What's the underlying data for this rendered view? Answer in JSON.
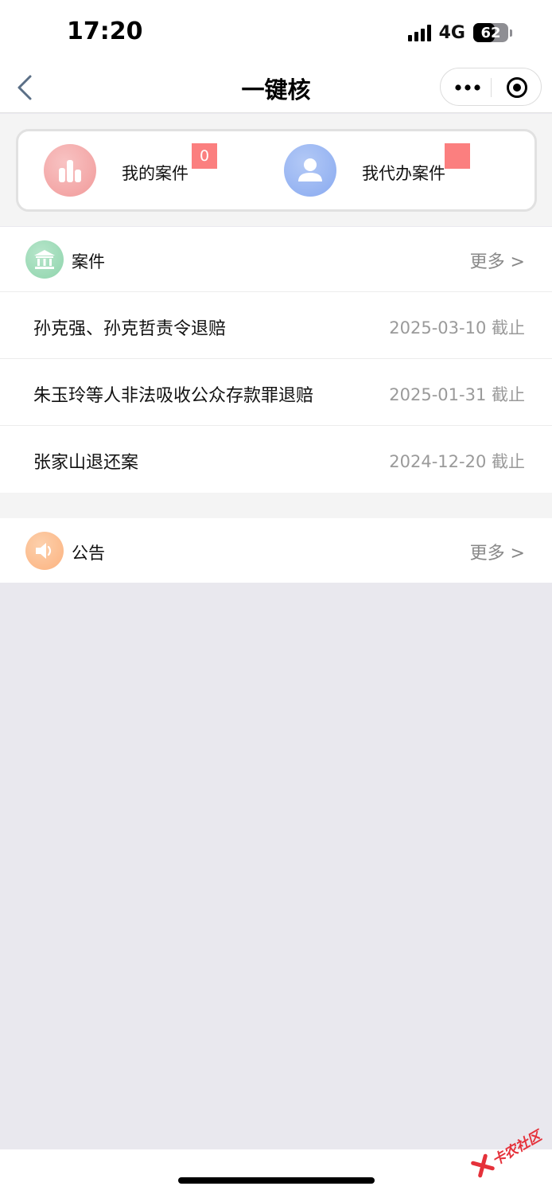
{
  "status_bar": {
    "time": "17:20",
    "network": "4G",
    "battery": "62",
    "battery_level": 0.62
  },
  "nav": {
    "title": "一键核",
    "back_icon": "chevron-left-icon",
    "more_icon": "more-dots-icon",
    "close_icon": "target-circle-icon"
  },
  "quick_actions": [
    {
      "label": "我的案件",
      "badge": "0",
      "icon": "bar-chart-icon",
      "color": "#f19a9a"
    },
    {
      "label": "我代办案件",
      "badge": "",
      "icon": "user-icon",
      "color": "#89aaf0"
    }
  ],
  "cases_section": {
    "title": "案件",
    "more": "更多 >",
    "icon": "bank-icon",
    "color": "#8fd4ac",
    "items": [
      {
        "title": "孙克强、孙克哲责令退赔",
        "deadline": "2025-03-10 截止"
      },
      {
        "title": "朱玉玲等人非法吸收公众存款罪退赔",
        "deadline": "2025-01-31 截止"
      },
      {
        "title": "张家山退还案",
        "deadline": "2024-12-20 截止"
      }
    ]
  },
  "notice_section": {
    "title": "公告",
    "more": "更多 >",
    "icon": "speaker-icon",
    "color": "#fbb27f"
  },
  "watermark": {
    "text": "卡农社区"
  },
  "colors": {
    "badge": "#fb7f7f",
    "page_bg": "#e9e8ee",
    "band_bg": "#f4f4f4"
  }
}
